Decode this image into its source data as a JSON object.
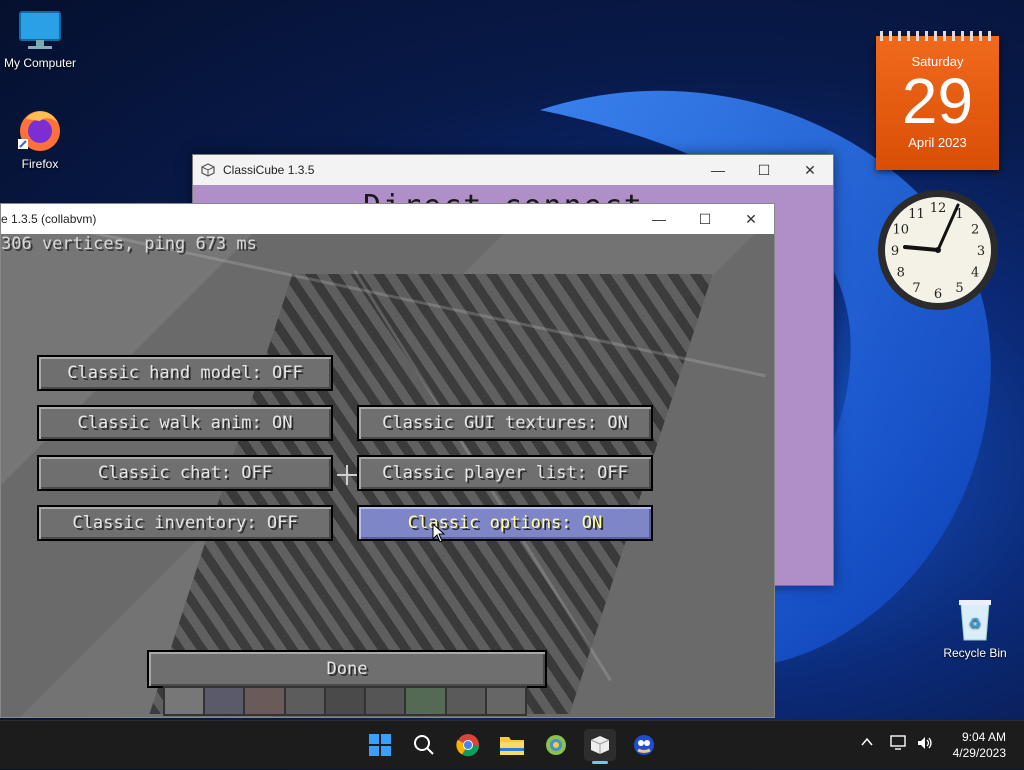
{
  "desktop": {
    "icons": [
      {
        "label": "My Computer"
      },
      {
        "label": "Firefox"
      },
      {
        "label": "Recycle Bin"
      }
    ]
  },
  "calendar": {
    "weekday": "Saturday",
    "day": "29",
    "month_year": "April 2023"
  },
  "clock_gadget": {
    "numerals": [
      "12",
      "1",
      "2",
      "3",
      "4",
      "5",
      "6",
      "7",
      "8",
      "9",
      "10",
      "11"
    ]
  },
  "back_window": {
    "title": "ClassiCube 1.3.5",
    "banner_text": "Direct connect"
  },
  "front_window": {
    "title": "e 1.3.5 (collabvm)",
    "debug_text": "306 vertices, ping 673 ms",
    "buttons": [
      {
        "label": "Classic hand model: OFF",
        "active": false
      },
      {
        "label": "Classic walk anim: ON",
        "active": false
      },
      {
        "label": "Classic GUI textures: ON",
        "active": false
      },
      {
        "label": "Classic chat: OFF",
        "active": false
      },
      {
        "label": "Classic player list: OFF",
        "active": false
      },
      {
        "label": "Classic inventory: OFF",
        "active": false
      },
      {
        "label": "Classic options: ON",
        "active": true
      }
    ],
    "done_label": "Done"
  },
  "taskbar": {
    "apps": [
      "start-icon",
      "search-icon",
      "chrome-icon",
      "file-explorer-icon",
      "collabvm-icon",
      "classicube-icon",
      "sonic-icon"
    ],
    "time": "9:04 AM",
    "date": "4/29/2023"
  },
  "colors": {
    "accent_taskbar": "#60cdff",
    "calendar": "#e85c10",
    "active_button": "#7f86c8",
    "active_button_text": "#ffffa0"
  }
}
